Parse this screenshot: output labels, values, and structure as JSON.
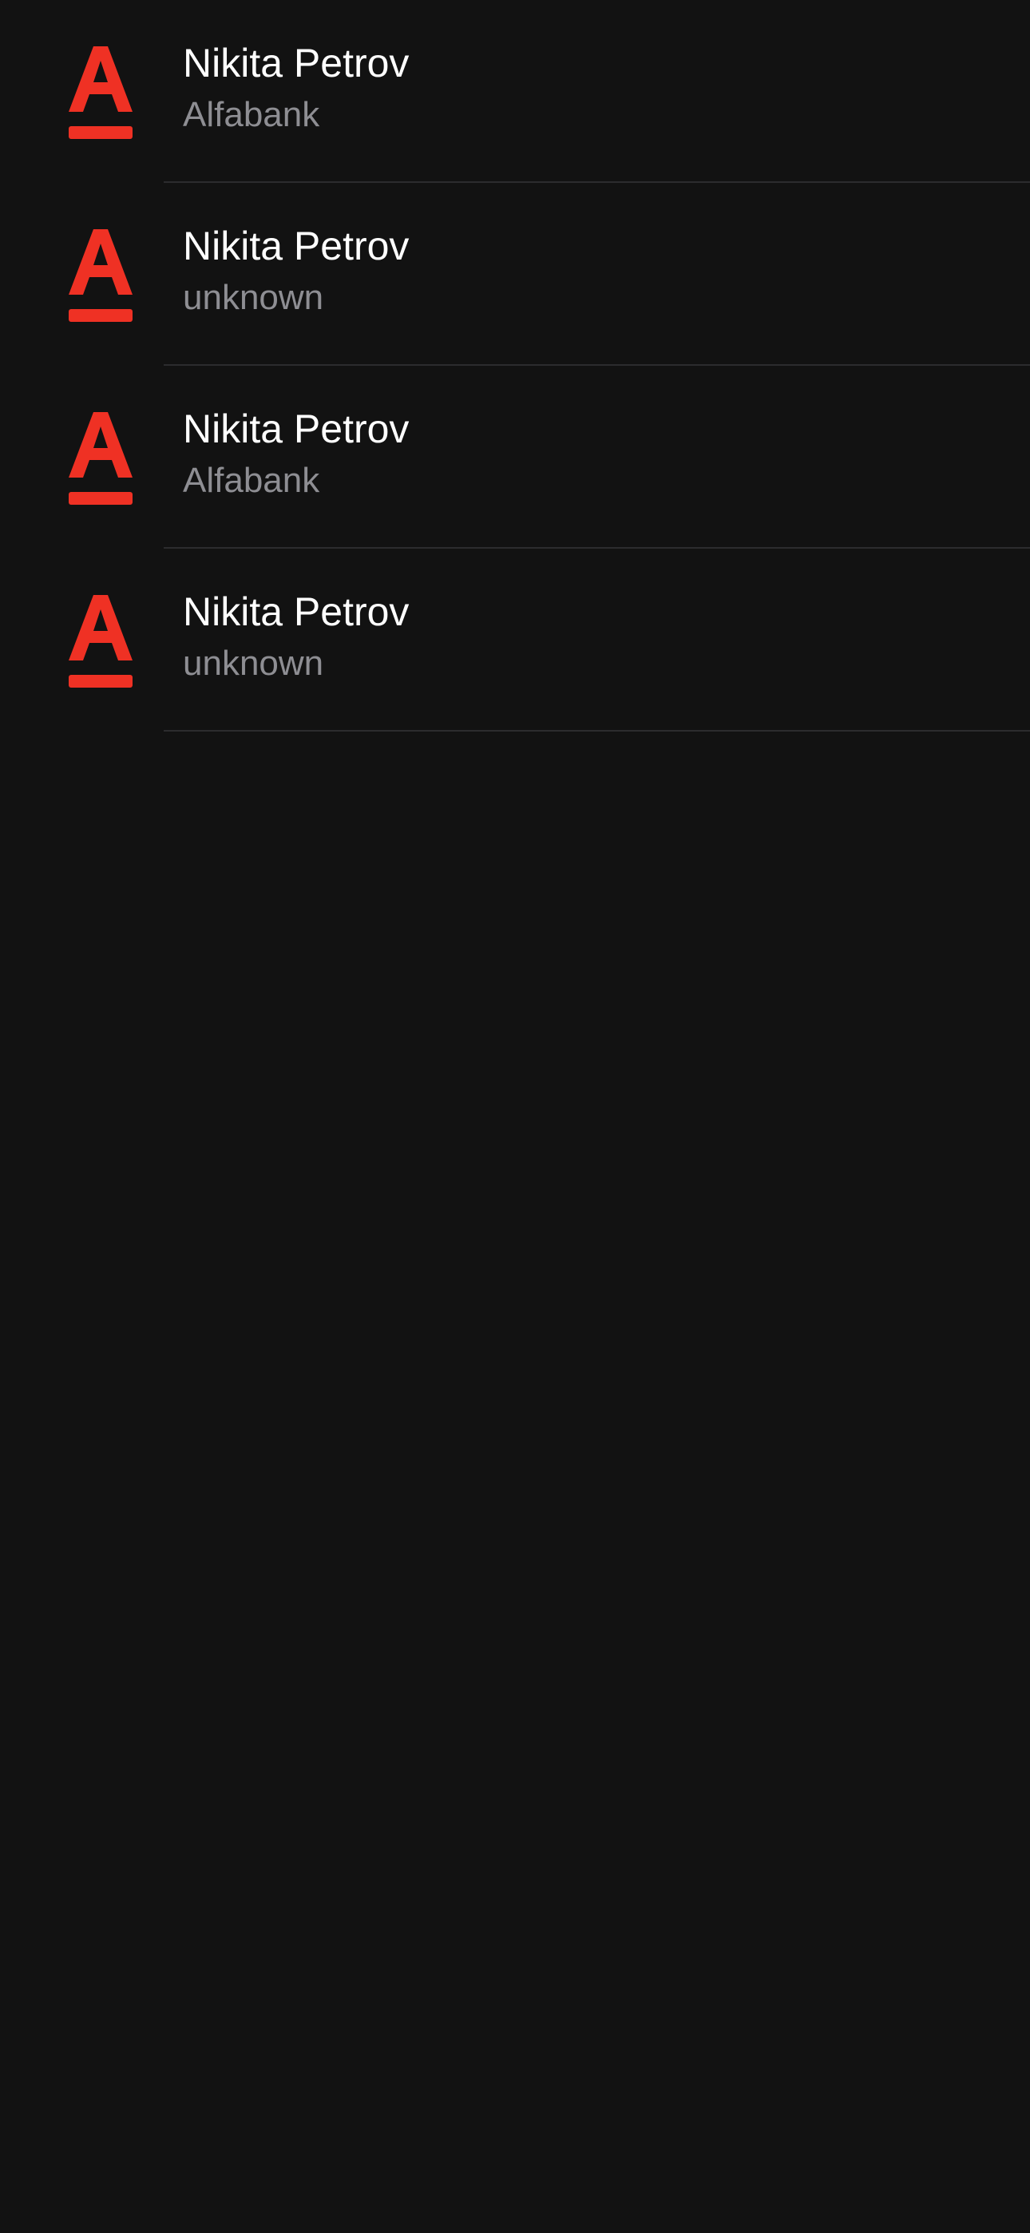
{
  "colors": {
    "background": "#121212",
    "title": "#ffffff",
    "subtitle": "#8e8e93",
    "separator": "#2c2c2e",
    "brand": "#ef3124"
  },
  "items": [
    {
      "title": "Nikita Petrov",
      "subtitle": "Alfabank",
      "icon": "alfabank-logo-icon"
    },
    {
      "title": "Nikita Petrov",
      "subtitle": "unknown",
      "icon": "alfabank-logo-icon"
    },
    {
      "title": "Nikita Petrov",
      "subtitle": "Alfabank",
      "icon": "alfabank-logo-icon"
    },
    {
      "title": "Nikita Petrov",
      "subtitle": "unknown",
      "icon": "alfabank-logo-icon"
    }
  ]
}
